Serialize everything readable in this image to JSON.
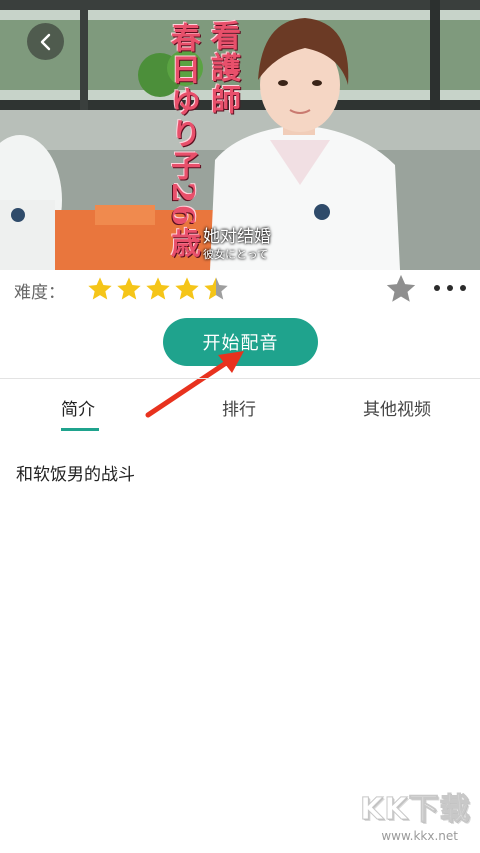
{
  "video": {
    "caption_cn": "她对结婚",
    "caption_jp": "彼女にとって",
    "title_col1": "看護師",
    "title_col2": "春日ゆり子26歳"
  },
  "difficulty": {
    "label": "难度：",
    "rating": 4.5,
    "max": 5,
    "star_color": "#f5c518",
    "empty_star_color": "#9e9e9e"
  },
  "start_button": {
    "label": "开始配音",
    "color": "#1fa38d"
  },
  "tabs": [
    {
      "label": "简介",
      "active": true
    },
    {
      "label": "排行",
      "active": false
    },
    {
      "label": "其他视频",
      "active": false
    }
  ],
  "intro": {
    "text": "和软饭男的战斗"
  },
  "watermark": {
    "logo": "KK下载",
    "url": "www.kkx.net"
  },
  "annotation": {
    "arrow_color": "#e8321e"
  }
}
